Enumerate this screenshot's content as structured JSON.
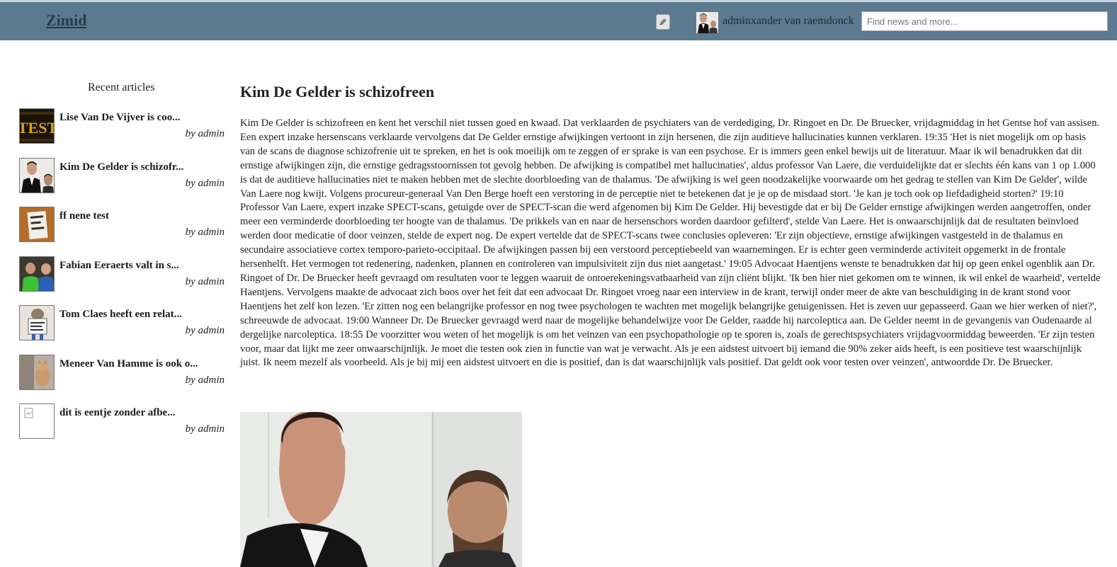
{
  "header": {
    "logo": "Zimid",
    "username": "adminxander van raemdonck",
    "search_placeholder": "Find news and more...",
    "edit_icon": "pencil-icon",
    "colors": {
      "bar": "#5b7a8f",
      "logo": "#2a3a46"
    }
  },
  "sidebar": {
    "title": "Recent articles",
    "items": [
      {
        "title": "Lise Van De Vijver is coo...",
        "byline": "by admin",
        "thumb": "test-image"
      },
      {
        "title": "Kim De Gelder is schizofr...",
        "byline": "by admin",
        "thumb": "courtroom-photo"
      },
      {
        "title": "ff nene test",
        "byline": "by admin",
        "thumb": "note-photo"
      },
      {
        "title": "Fabian Eeraerts valt in s...",
        "byline": "by admin",
        "thumb": "people-photo"
      },
      {
        "title": "Tom Claes heeft een relat...",
        "byline": "by admin",
        "thumb": "cartoon-photo"
      },
      {
        "title": "Meneer Van Hamme is ook o...",
        "byline": "by admin",
        "thumb": "cat-photo"
      },
      {
        "title": "dit is eentje zonder afbe...",
        "byline": "by admin",
        "thumb": "broken-image"
      }
    ]
  },
  "article": {
    "title": "Kim De Gelder is schizofreen",
    "body": "Kim De Gelder is schizofreen en kent het verschil niet tussen goed en kwaad. Dat verklaarden de psychiaters van de verdediging, Dr. Ringoet en Dr. De Bruecker, vrijdagmiddag in het Gentse hof van assisen. Een expert inzake hersenscans verklaarde vervolgens dat De Gelder ernstige afwijkingen vertoont in zijn hersenen, die zijn auditieve hallucinaties kunnen verklaren. 19:35 'Het is niet mogelijk om op basis van de scans de diagnose schizofrenie uit te spreken, en het is ook moeilijk om te zeggen of er sprake is van een psychose. Er is immers geen enkel bewijs uit de literatuur. Maar ik wil benadrukken dat dit ernstige afwijkingen zijn, die ernstige gedragsstoornissen tot gevolg hebben. De afwijking is compatibel met hallucinaties', aldus professor Van Laere, die verduidelijkte dat er slechts één kans van 1 op 1.000 is dat de auditieve hallucinaties niet te maken hebben met de slechte doorbloeding van de thalamus. 'De afwijking is wel geen noodzakelijke voorwaarde om het gedrag te stellen van Kim De Gelder', wilde Van Laere nog kwijt. Volgens procureur-generaal Van Den Berge hoeft een verstoring in de perceptie niet te betekenen dat je je op de misdaad stort. 'Je kan je toch ook op liefdadigheid storten?' 19:10 Professor Van Laere, expert inzake SPECT-scans, getuigde over de SPECT-scan die werd afgenomen bij Kim De Gelder. Hij bevestigde dat er bij De Gelder ernstige afwijkingen werden aangetroffen, onder meer een verminderde doorbloeding ter hoogte van de thalamus. 'De prikkels van en naar de hersenschors worden daardoor gefilterd', stelde Van Laere. Het is onwaarschijnlijk dat de resultaten beïnvloed werden door medicatie of door veinzen, stelde de expert nog. De expert vertelde dat de SPECT-scans twee conclusies opleveren: 'Er zijn objectieve, ernstige afwijkingen vastgesteld in de thalamus en secundaire associatieve cortex temporo-parieto-occipitaal. De afwijkingen passen bij een verstoord perceptiebeeld van waarnemingen. Er is echter geen verminderde activiteit opgemerkt in de frontale hersenhelft. Het vermogen tot redenering, nadenken, plannen en controleren van impulsiviteit zijn dus niet aangetast.' 19:05 Advocaat Haentjens wenste te benadrukken dat hij op geen enkel ogenblik aan Dr. Ringoet of Dr. De Bruecker heeft gevraagd om resultaten voor te leggen waaruit de ontoerekeningsvatbaarheid van zijn cliënt blijkt. 'Ik ben hier niet gekomen om te winnen, ik wil enkel de waarheid', vertelde Haentjens. Vervolgens maakte de advocaat zich boos over het feit dat een advocaat Dr. Ringoet vroeg naar een interview in de krant, terwijl onder meer de akte van beschuldiging in de krant stond voor Haentjens het zelf kon lezen. 'Er zitten nog een belangrijke professor en nog twee psychologen te wachten met mogelijk belangrijke getuigenissen. Het is zeven uur gepasseerd. Gaan we hier werken of niet?', schreeuwde de advocaat. 19:00 Wanneer Dr. De Bruecker gevraagd werd naar de mogelijke behandelwijze voor De Gelder, raadde hij narcoleptica aan. De Gelder neemt in de gevangenis van Oudenaarde al dergelijke narcoleptica. 18:55 De voorzitter wou weten of het mogelijk is om het veinzen van een psychopathologie op te sporen is, zoals de gerechtspsychiaters vrijdagvoormiddag beweerden. 'Er zijn testen voor, maar dat lijkt me zeer onwaarschijnlijk. Je moet die testen ook zien in functie van wat je verwacht. Als je een aidstest uitvoert bij iemand die 90% zeker aids heeft, is een positieve test waarschijnlijk juist. Ik neem mezelf als voorbeeld. Als je bij mij een aidstest uitvoert en die is positief, dan is dat waarschijnlijk vals positief. Dat geldt ook voor testen over veinzen', antwoordde Dr. De Bruecker.",
    "image": "courtroom-photo"
  }
}
